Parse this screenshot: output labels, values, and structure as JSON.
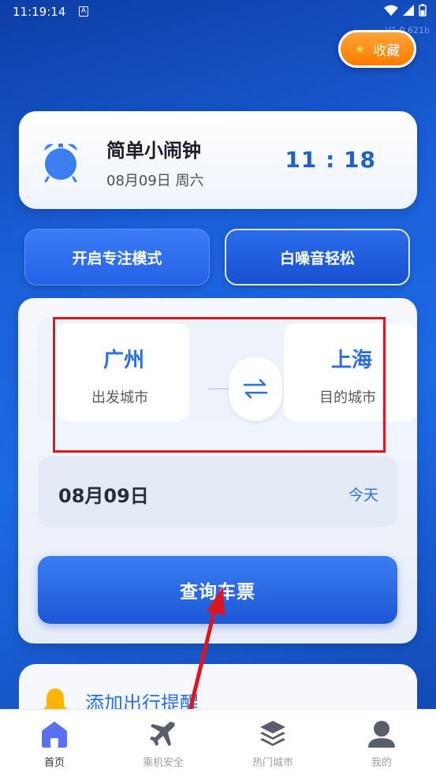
{
  "status_bar": {
    "time": "11:19:14",
    "badge": "A"
  },
  "version": "V1.0.621b",
  "favorite_button": {
    "label": "收藏",
    "icon": "star-icon"
  },
  "clock_card": {
    "title": "简单小闹钟",
    "date": "08月09日 周六",
    "time": "11 : 18",
    "icon": "alarm-clock-icon"
  },
  "mode_buttons": {
    "focus": "开启专注模式",
    "white_noise": "白噪音轻松"
  },
  "route": {
    "from_city": "广州",
    "from_label": "出发城市",
    "to_city": "上海",
    "to_label": "目的城市",
    "swap_icon": "swap-arrows-icon"
  },
  "date_row": {
    "date": "08月09日",
    "today": "今天"
  },
  "search_button": "查询车票",
  "reminder": {
    "text": "添加出行提醒",
    "icon": "bell-icon"
  },
  "bottom_nav": [
    {
      "label": "首页",
      "icon": "home-icon",
      "active": true
    },
    {
      "label": "乘机安全",
      "icon": "airplane-icon",
      "active": false
    },
    {
      "label": "热门城市",
      "icon": "layers-icon",
      "active": false
    },
    {
      "label": "我的",
      "icon": "user-icon",
      "active": false
    }
  ],
  "colors": {
    "accent": "#2a6de0",
    "favorite": "#ff8a14",
    "highlight": "#e0141e"
  }
}
